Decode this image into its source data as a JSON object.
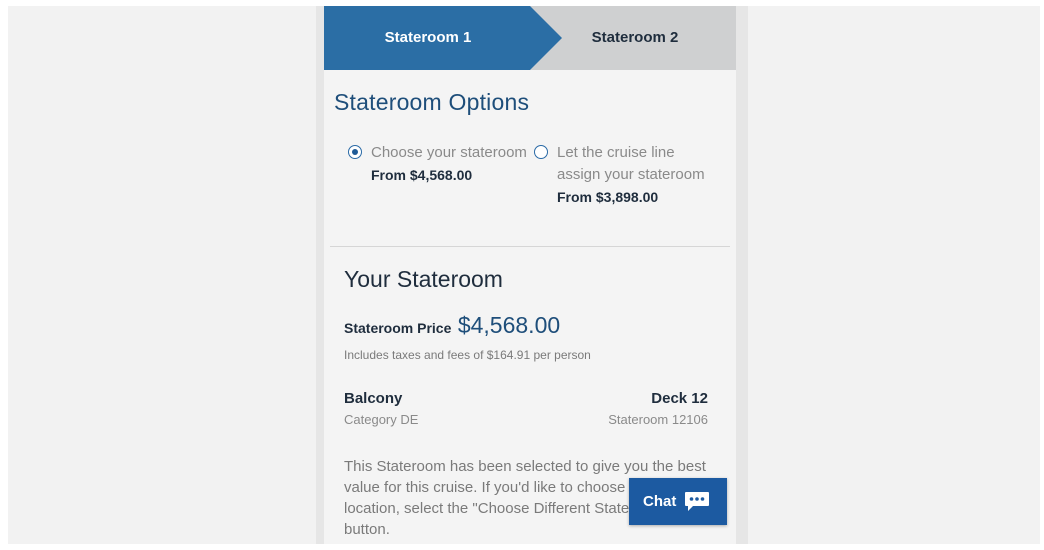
{
  "steps": [
    {
      "label": "Stateroom 1",
      "active": true
    },
    {
      "label": "Stateroom 2",
      "active": false
    }
  ],
  "options": {
    "title": "Stateroom Options",
    "choose": {
      "label": "Choose your stateroom",
      "price": "From $4,568.00",
      "selected": true
    },
    "assign": {
      "label": "Let the cruise line assign your stateroom",
      "price": "From $3,898.00",
      "selected": false
    }
  },
  "your_stateroom": {
    "title": "Your Stateroom",
    "price_label": "Stateroom Price",
    "price_value": "$4,568.00",
    "fees": "Includes taxes and fees of $164.91 per person",
    "type": "Balcony",
    "category": "Category DE",
    "deck": "Deck 12",
    "stateroom": "Stateroom 12106",
    "description": "This Stateroom has been selected to give you the best value for this cruise. If you'd like to choose another location, select the \"Choose Different Stateroom\" button."
  },
  "chat": {
    "label": "Chat",
    "icon": "chat-bubble-icon"
  },
  "colors": {
    "active_step": "#2b6ea5",
    "inactive_step": "#cfd0d1",
    "heading_blue": "#1e4e7a",
    "chat_blue": "#1c5aa1"
  }
}
